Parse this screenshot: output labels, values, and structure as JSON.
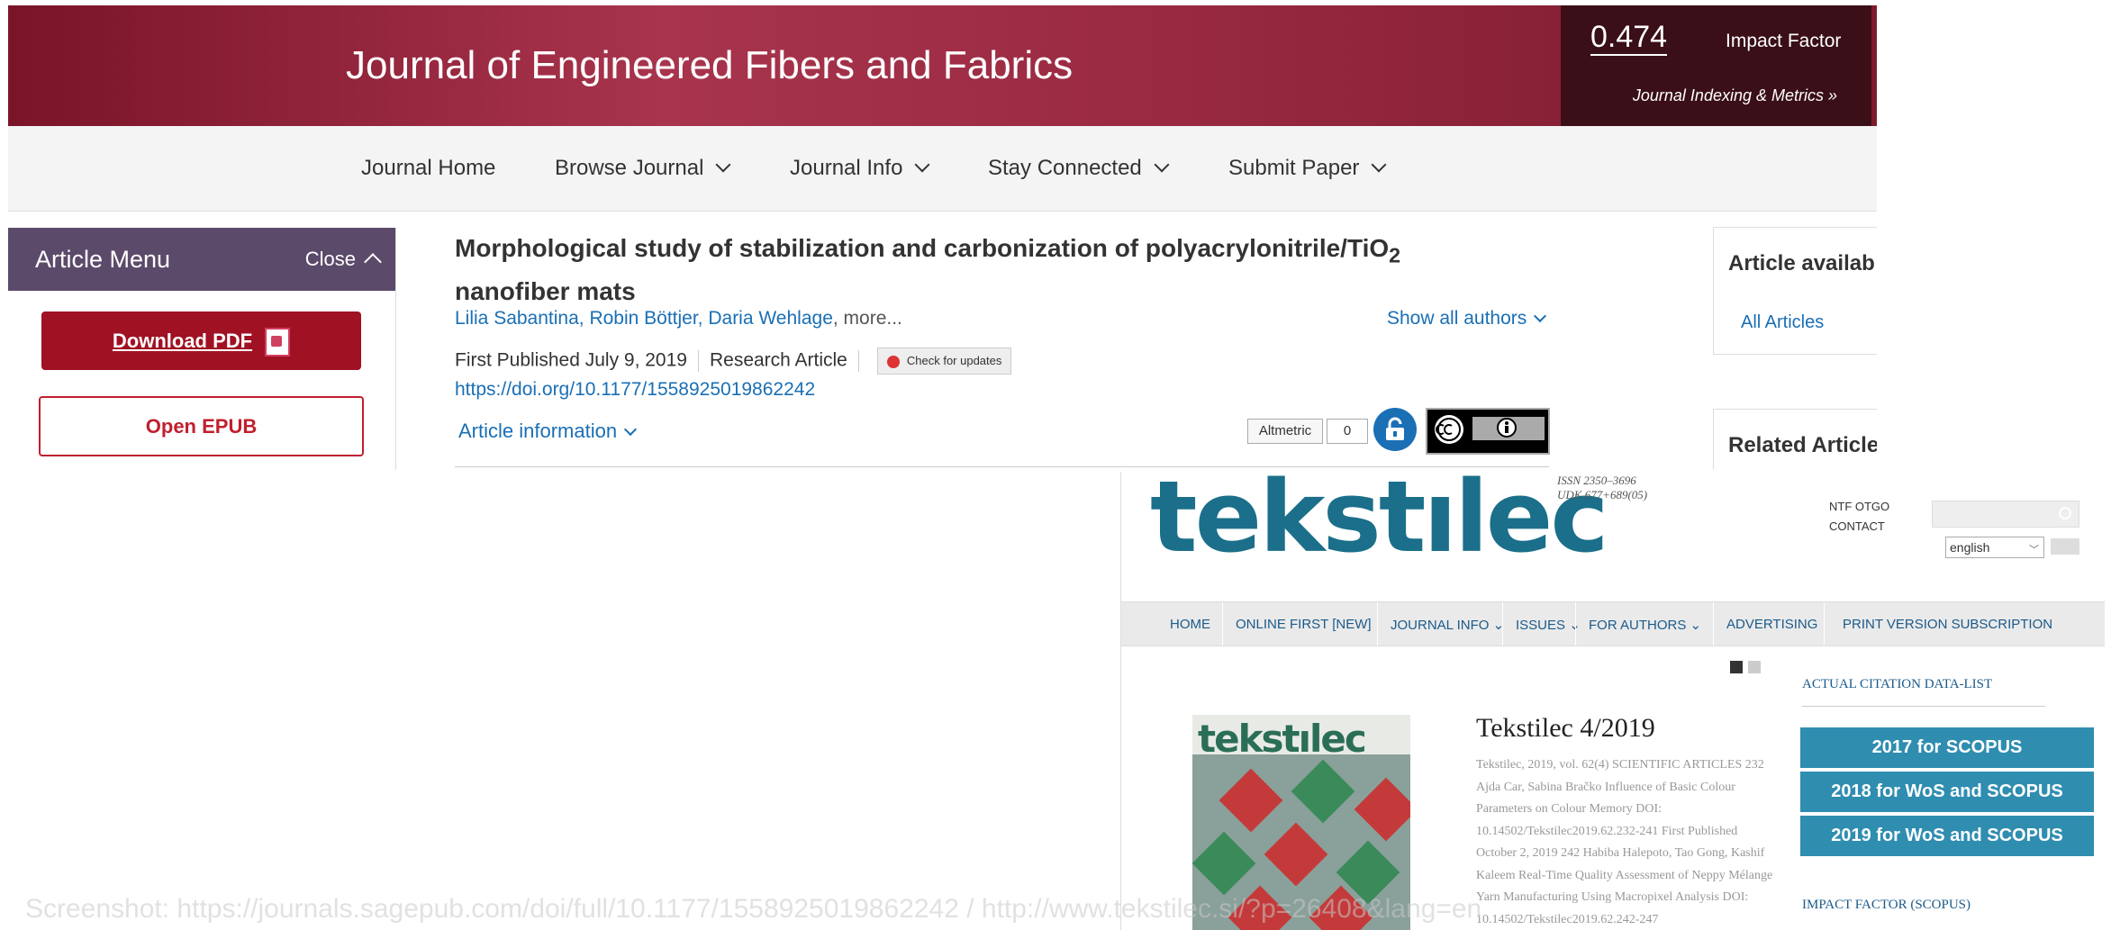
{
  "sage": {
    "banner_title": "Journal of Engineered Fibers and Fabrics",
    "impact_factor_value": "0.474",
    "impact_factor_label": "Impact Factor",
    "metrics_link": "Journal Indexing & Metrics »",
    "nav": [
      "Journal Home",
      "Browse Journal",
      "Journal Info",
      "Stay Connected",
      "Submit Paper"
    ],
    "article_menu": {
      "title": "Article Menu",
      "close": "Close",
      "download_pdf": "Download PDF",
      "open_epub": "Open EPUB"
    },
    "article": {
      "title_main": "Morphological study of stabilization and carbonization of polyacrylonitrile/TiO",
      "title_sub": "2",
      "title_line2": "nanofiber mats",
      "authors": "Lilia Sabantina, Robin Böttjer, Daria Wehlage",
      "authors_more": ", more...",
      "show_all_authors": "Show all authors",
      "first_published": "First Published July 9, 2019",
      "article_type": "Research Article",
      "check_updates": "Check for updates",
      "doi": "https://doi.org/10.1177/1558925019862242",
      "article_information": "Article information",
      "altmetric_label": "Altmetric",
      "altmetric_count": "0"
    },
    "right": {
      "availability_title": "Article availab",
      "all_articles": "All Articles",
      "related_title": "Related Article"
    }
  },
  "tekstilec": {
    "logo": "tekstılec",
    "issn": "ISSN 2350–3696",
    "udk": "UDK 677+689(05)",
    "top_links": [
      "NTF OTGO",
      "CONTACT"
    ],
    "language": "english",
    "nav": [
      "HOME",
      "ONLINE FIRST [NEW]",
      "JOURNAL INFO",
      "ISSUES",
      "FOR AUTHORS",
      "ADVERTISING",
      "PRINT VERSION SUBSCRIPTION"
    ],
    "cover_logo": "tekstılec",
    "issue_title": "Tekstilec 4/2019",
    "issue_text": "Tekstilec, 2019, vol. 62(4) SCIENTIFIC ARTICLES 232 Ajda Car, Sabina Bračko Influence of Basic Colour Parameters on Colour Memory DOI: 10.14502/Tekstilec2019.62.232-241 First Published October 2, 2019 242 Habiba Halepoto, Tao Gong, Kashif Kaleem Real-Time Quality Assessment of Neppy Mélange Yarn Manufacturing Using Macropixel Analysis DOI: 10.14502/Tekstilec2019.62.242-247",
    "sidebar_heading": "ACTUAL CITATION DATA-LIST",
    "sidebar_buttons": [
      "2017 for SCOPUS",
      "2018 for WoS and SCOPUS",
      "2019 for WoS and SCOPUS"
    ],
    "sidebar_heading2": "IMPACT FACTOR (SCOPUS)"
  },
  "caption": "Screenshot: https://journals.sagepub.com/doi/full/10.1177/1558925019862242  /  http://www.tekstilec.si/?p=26408&lang=en",
  "colors": {
    "sage_banner": "#8c2238",
    "sage_menu_head": "#5c4a6a",
    "sage_pdf_button": "#a01123",
    "link_blue": "#1a6fb5",
    "tekstilec_logo": "#1b6f8a",
    "tekstilec_button": "#2f8db0"
  }
}
